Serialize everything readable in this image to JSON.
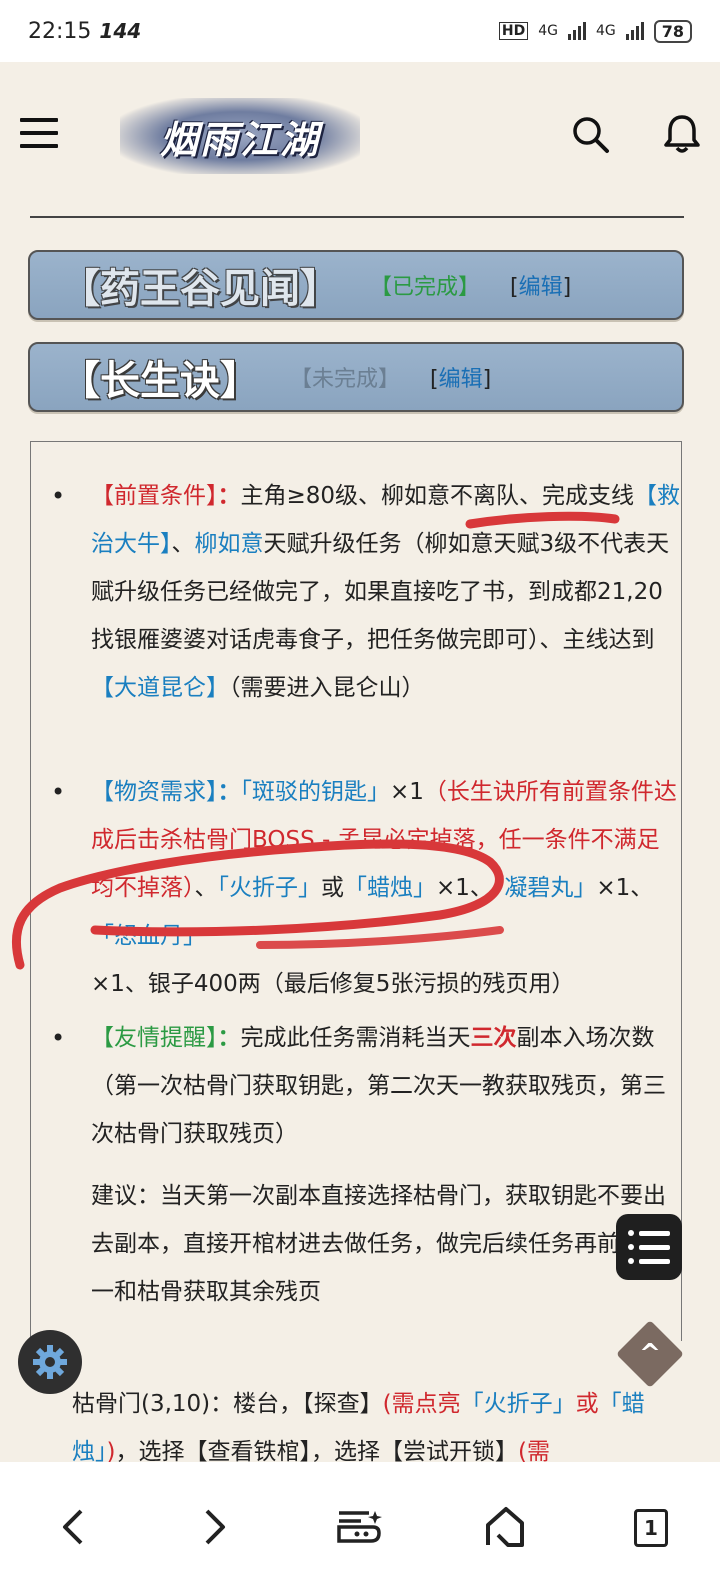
{
  "status_bar": {
    "time": "22:15",
    "refresh_rate": "144",
    "network_1": "4G",
    "network_2": "4G",
    "hd_badge": "HD",
    "battery": "78"
  },
  "header": {
    "logo_text": "烟雨江湖"
  },
  "quests": [
    {
      "title": "【药王谷见闻】",
      "status": "【已完成】",
      "status_color": "#2b9a43",
      "edit_open": "[",
      "edit_label": "编辑",
      "edit_close": "]"
    },
    {
      "title": "【长生诀】",
      "status": "【未完成】",
      "status_color": "#6b7f93",
      "edit_open": "[",
      "edit_label": "编辑",
      "edit_close": "]"
    }
  ],
  "content": {
    "prereq": {
      "label": "【前置条件】",
      "colon": "：",
      "t1": "主角≥80级、柳如意不离队、完成支线",
      "link1": "【救治大牛】",
      "t2": "、",
      "link2": "柳如意",
      "t3": "天赋升级任务（柳如意天赋3级不代表天赋升级任务已经做完了，如果直接吃了书，到成都21,20找银雁婆婆对话虎毒食子，把任务做完即可）、主线达到",
      "link3": "【大道昆仑】",
      "t4": "（需要进入昆仑山）"
    },
    "materials": {
      "label": "【物资需求】",
      "colon": "：",
      "item1": "「斑驳的钥匙」",
      "q1": "×1",
      "note": "（长生诀所有前置条件达成后击杀枯骨门BOSS - 孟昆必定掉落，任一条件不满足均不掉落）",
      "t_sep": "、",
      "item2": "「火折子」",
      "t_or": "或",
      "item3": "「蜡烛」",
      "q3": "×1、",
      "item4": "「凝碧丸」",
      "q4": "×1、",
      "item5": "「怒血丹」",
      "q5": "×1、银子400两（最后修复5张污损的残页用）"
    },
    "tip": {
      "label": "【友情提醒】",
      "colon": "：",
      "t1": "完成此任务需消耗当天",
      "emph": "三次",
      "t2": "副本入场次数（第一次枯骨门获取钥匙，第二次天一教获取残页，第三次枯骨门获取残页）"
    },
    "suggestion": "建议：当天第一次副本直接选择枯骨门，获取钥匙不要出去副本，直接开棺材进去做任务，做完后续任务再前往天一和枯骨获取其余残页",
    "tail": {
      "t1": "枯骨门(3,10)：楼台，【探查】",
      "r1": "(需点亮",
      "b1": "「火折子」",
      "r2": "或",
      "b2": "「蜡烛」",
      "r3": ")",
      "t2": "，选择【查看铁棺】，选择【尝试开锁】",
      "r4": "(需"
    }
  },
  "navbar": {
    "tab_count": "1"
  },
  "colors": {
    "accent_red": "#d0282e",
    "link_blue": "#1a7fc0",
    "green": "#2b9a43",
    "quest_bar": "#9bb3cc"
  }
}
